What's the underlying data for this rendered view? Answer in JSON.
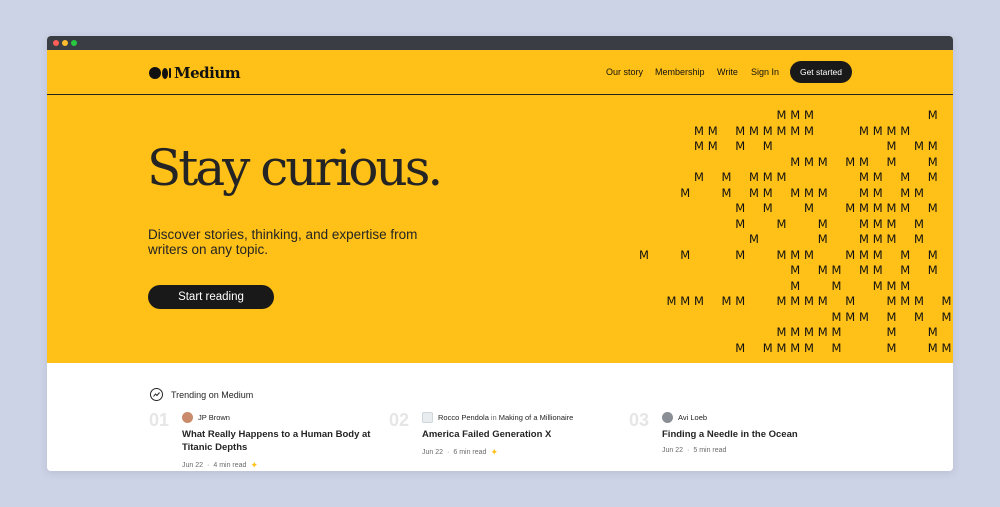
{
  "brand": {
    "name": "Medium"
  },
  "nav": {
    "links": [
      "Our story",
      "Membership",
      "Write",
      "Sign In"
    ],
    "cta": "Get started"
  },
  "hero": {
    "headline": "Stay curious.",
    "subtitle": "Discover stories, thinking, and expertise from writers on any topic.",
    "button": "Start reading",
    "pattern_glyph": "M"
  },
  "trending": {
    "label": "Trending on Medium",
    "items": [
      {
        "num": "01",
        "author": "JP Brown",
        "publication": "",
        "title": "What Really Happens to a Human Body at Titanic Depths",
        "date": "Jun 22",
        "read": "4 min read"
      },
      {
        "num": "02",
        "author": "Rocco Pendola",
        "publication": "Making of a Millionaire",
        "title": "America Failed Generation X",
        "date": "Jun 22",
        "read": "6 min read"
      },
      {
        "num": "03",
        "author": "Avi Loeb",
        "publication": "",
        "title": "Finding a Needle in the Ocean",
        "date": "Jun 22",
        "read": "5 min read"
      }
    ]
  },
  "colors": {
    "hero_bg": "#ffc017",
    "dark": "#191919",
    "page_bg": "#cdd3e6"
  }
}
